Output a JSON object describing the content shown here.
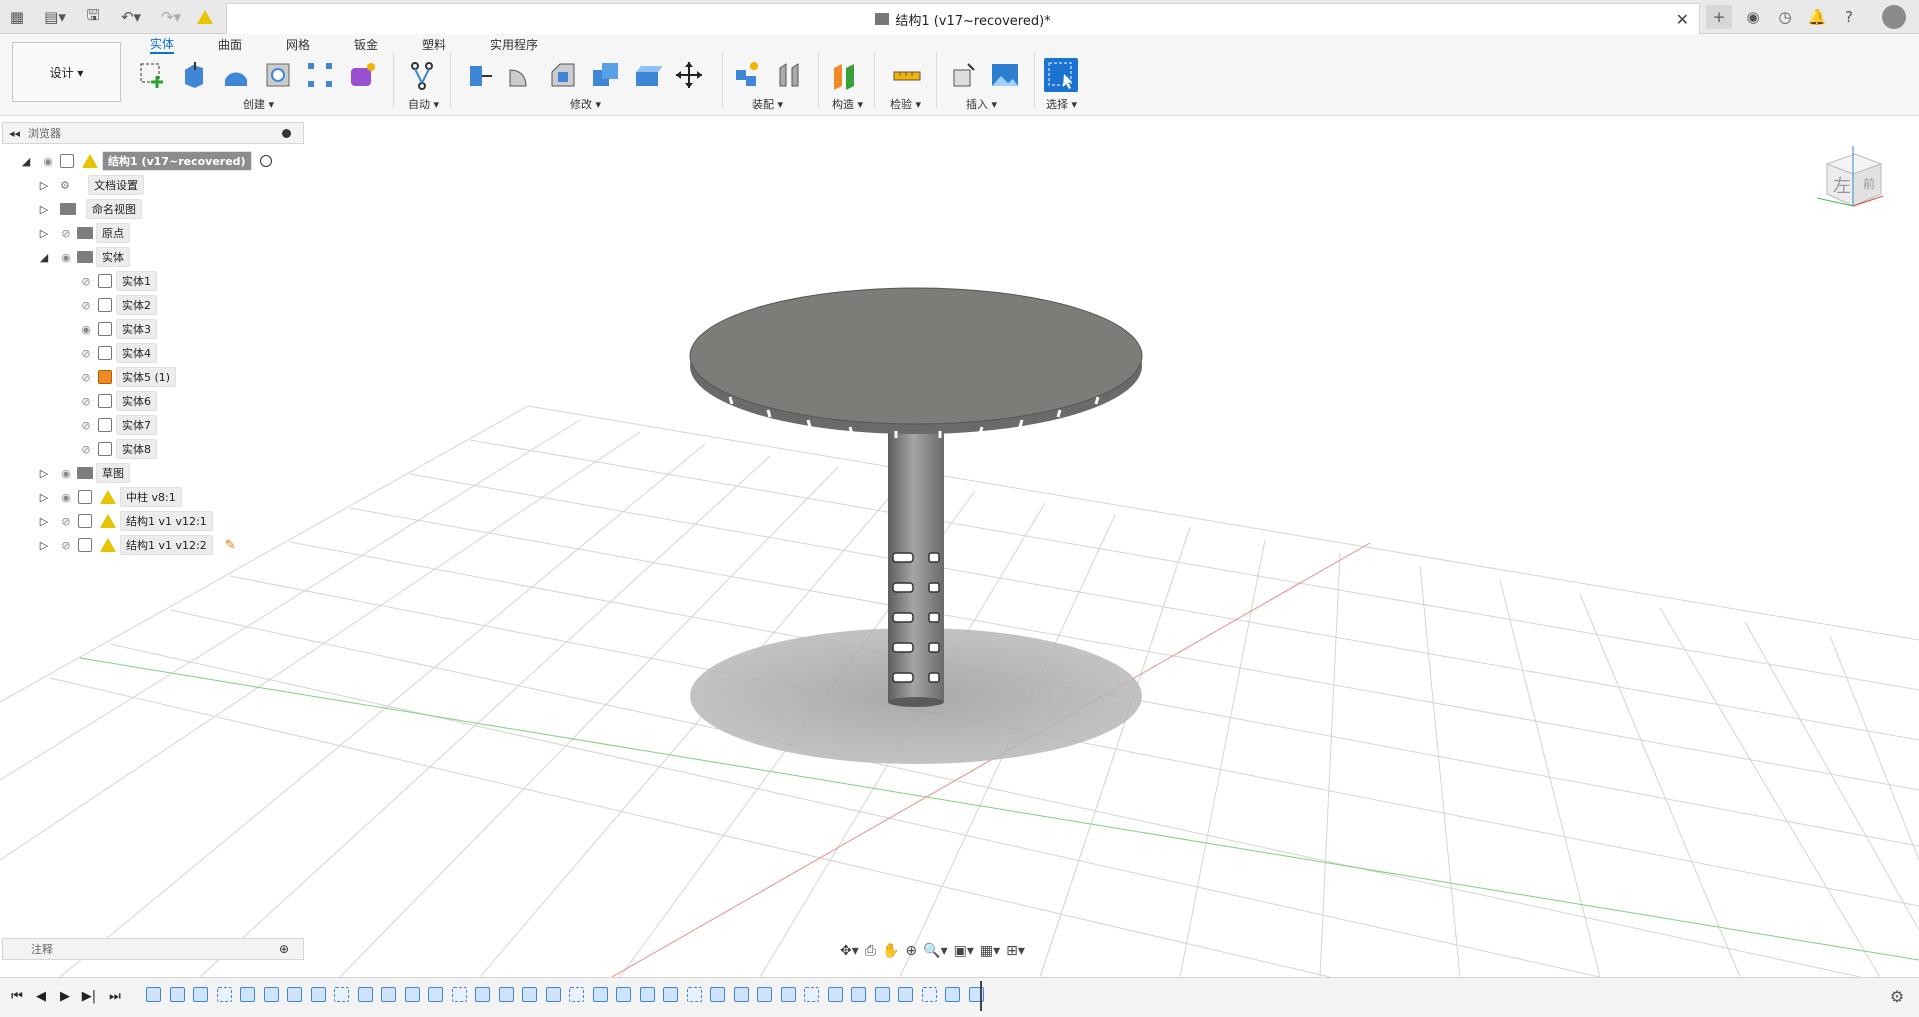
{
  "title": "结构1 (v17~recovered)*",
  "ribbon": {
    "workspace": "设计 ▾",
    "tabs": [
      "实体",
      "曲面",
      "网格",
      "钣金",
      "塑料",
      "实用程序"
    ],
    "groups": {
      "create": "创建 ▾",
      "auto": "自动 ▾",
      "modify": "修改 ▾",
      "assemble": "装配 ▾",
      "construct": "构造 ▾",
      "inspect": "检验 ▾",
      "insert": "插入 ▾",
      "select": "选择 ▾"
    }
  },
  "browser": {
    "title": "浏览器",
    "root": "结构1 (v17~recovered)",
    "items": [
      "文档设置",
      "命名视图",
      "原点",
      "实体",
      "实体1",
      "实体2",
      "实体3",
      "实体4",
      "实体5 (1)",
      "实体6",
      "实体7",
      "实体8",
      "草图",
      "中柱 v8:1",
      "结构1 v1 v12:1",
      "结构1 v1 v12:2"
    ]
  },
  "annotations": {
    "title": "注释"
  },
  "colors": {
    "accent": "#0a6fd6",
    "x_axis": "#e04040",
    "y_axis": "#40c040",
    "model": "#808080"
  }
}
